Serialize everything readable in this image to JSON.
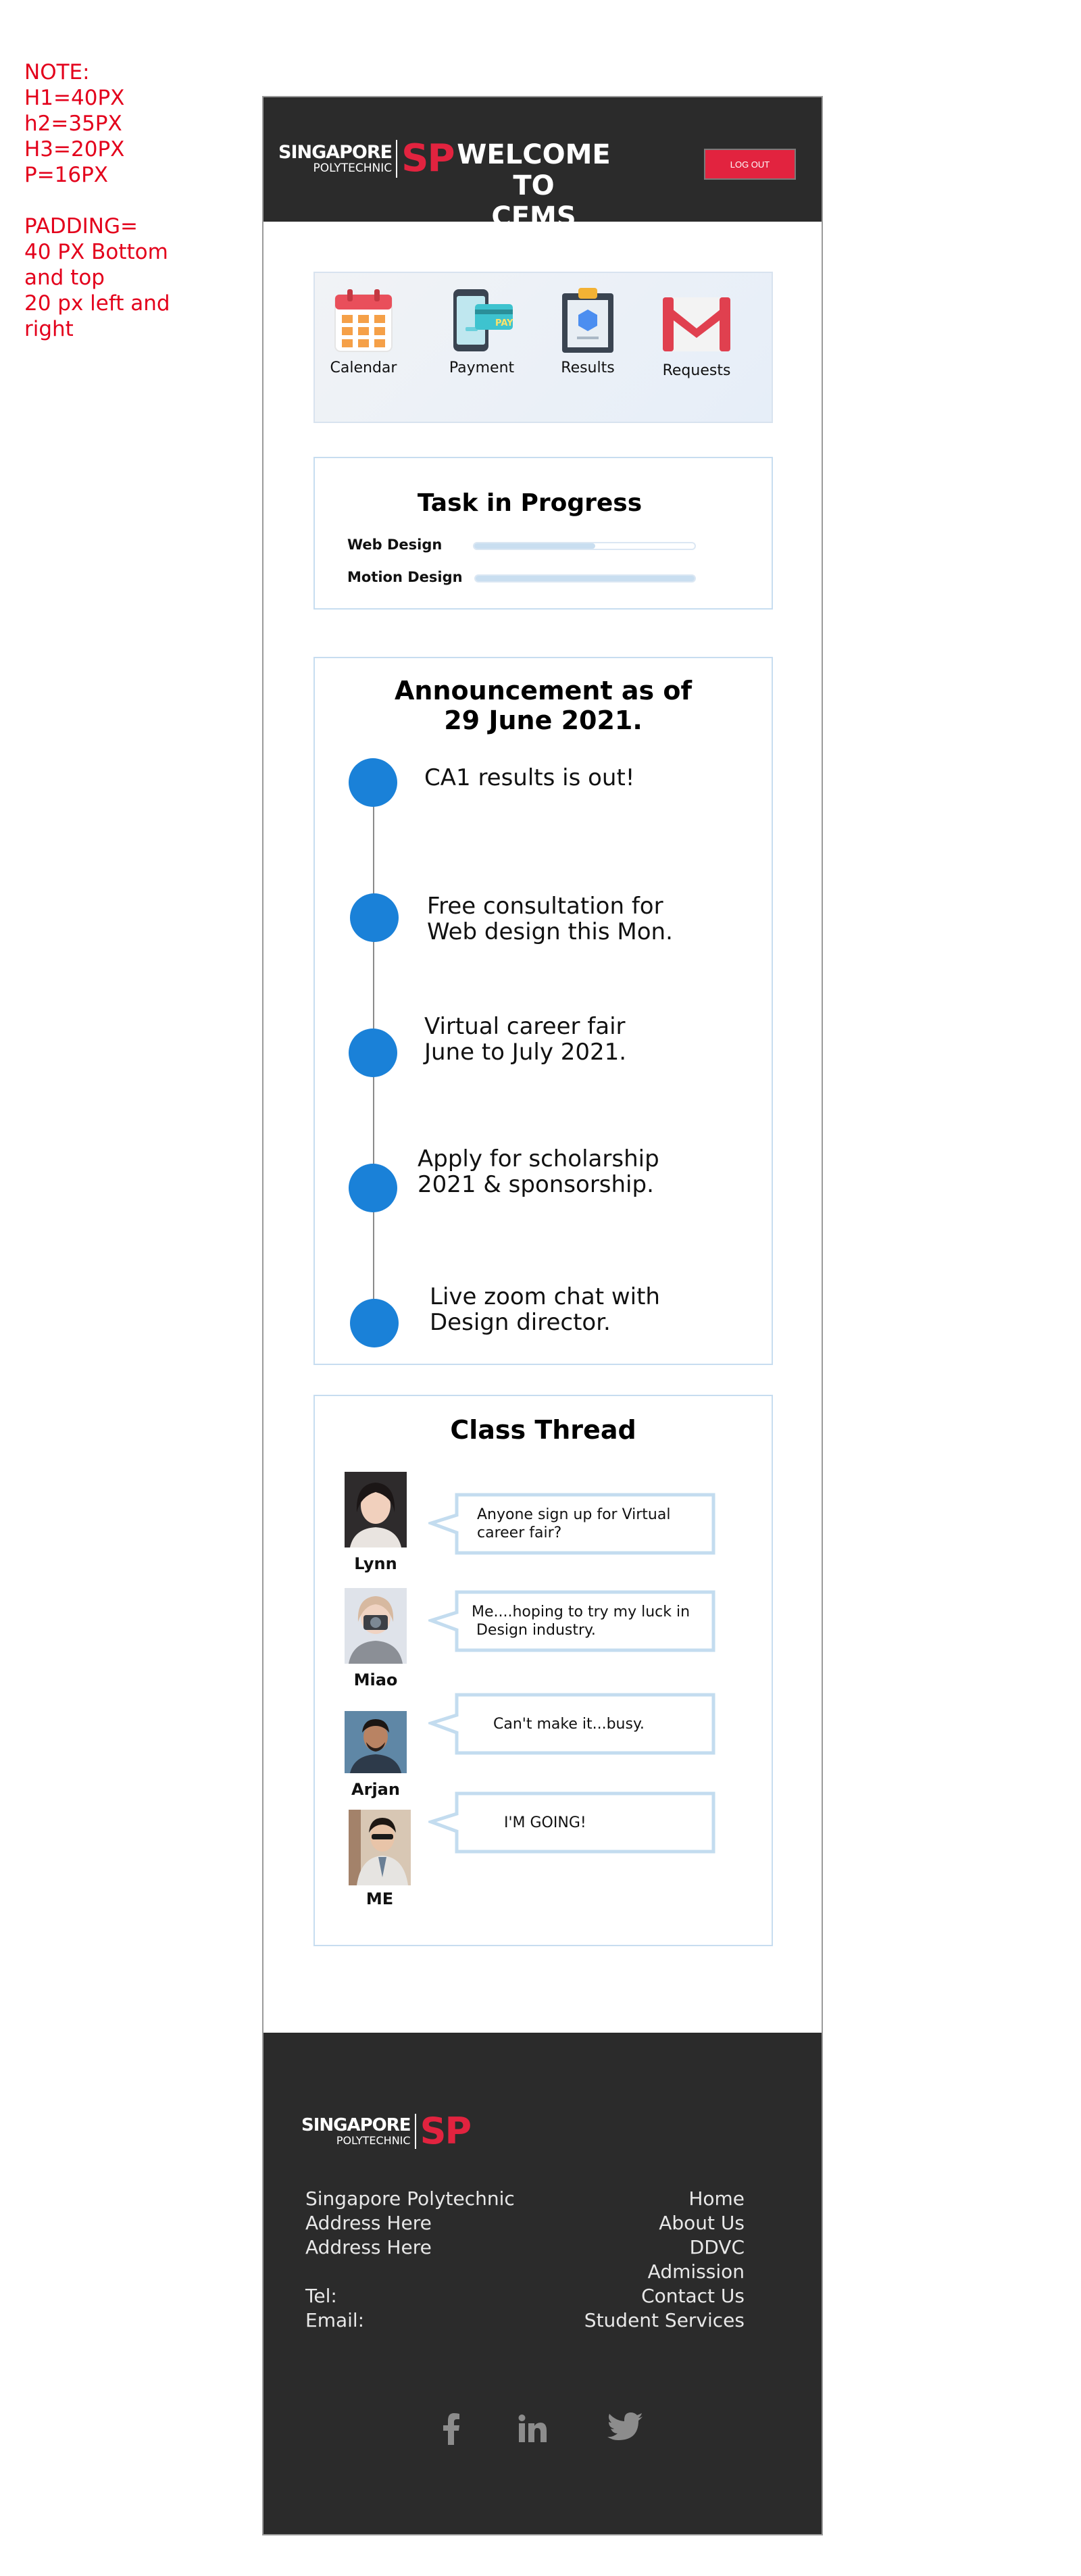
{
  "note": {
    "lines": [
      "NOTE:",
      "H1=40PX",
      "h2=35PX",
      "H3=20PX",
      "P=16PX"
    ],
    "padding_lines": [
      "PADDING=",
      "40 PX Bottom",
      "and top",
      "20 px left and",
      "right"
    ]
  },
  "header": {
    "logo_top": "SINGAPORE",
    "logo_bottom": "POLYTECHNIC",
    "logo_mark": "SP",
    "title_line1": "WELCOME TO",
    "title_line2": "CEMS",
    "logout_label": "LOG OUT"
  },
  "quick_links": [
    {
      "label": "Calendar",
      "icon": "calendar-icon"
    },
    {
      "label": "Payment",
      "icon": "payment-icon"
    },
    {
      "label": "Results",
      "icon": "results-icon"
    },
    {
      "label": "Requests",
      "icon": "mail-icon"
    }
  ],
  "tasks": {
    "title": "Task in Progress",
    "items": [
      {
        "label": "Web Design",
        "progress": 0.55
      },
      {
        "label": "Motion Design",
        "progress": 1.0
      }
    ]
  },
  "announcements": {
    "title_line1": "Announcement as of",
    "title_line2": "29 June 2021.",
    "items": [
      {
        "line1": "CA1 results is out!",
        "line2": ""
      },
      {
        "line1": "Free consultation for",
        "line2": "Web design this Mon."
      },
      {
        "line1": "Virtual career fair",
        "line2": "June to July 2021."
      },
      {
        "line1": "Apply for scholarship",
        "line2": "2021 & sponsorship."
      },
      {
        "line1": "Live zoom chat with",
        "line2": "Design director."
      }
    ]
  },
  "thread": {
    "title": "Class Thread",
    "posts": [
      {
        "name": "Lynn",
        "line1": "Anyone sign up for Virtual",
        "line2": "career fair?"
      },
      {
        "name": "Miao",
        "line1": "Me....hoping to try my luck in",
        "line2": " Design industry."
      },
      {
        "name": "Arjan",
        "line1": "Can't make it...busy.",
        "line2": ""
      },
      {
        "name": "ME",
        "line1": "I'M GOING!",
        "line2": ""
      }
    ]
  },
  "footer": {
    "logo_top": "SINGAPORE",
    "logo_bottom": "POLYTECHNIC",
    "logo_mark": "SP",
    "address": [
      "Singapore Polytechnic",
      "Address Here",
      "Address Here",
      "",
      "Tel:",
      "Email:"
    ],
    "links": [
      "Home",
      "About Us",
      "DDVC",
      "Admission",
      "Contact Us",
      "Student Services"
    ],
    "social": [
      "facebook-icon",
      "linkedin-icon",
      "twitter-icon"
    ]
  },
  "colors": {
    "brand_red": "#e2233f",
    "dark_bg": "#2b2b2b",
    "accent_blue": "#1a81d8",
    "note_red": "#e3001b"
  }
}
